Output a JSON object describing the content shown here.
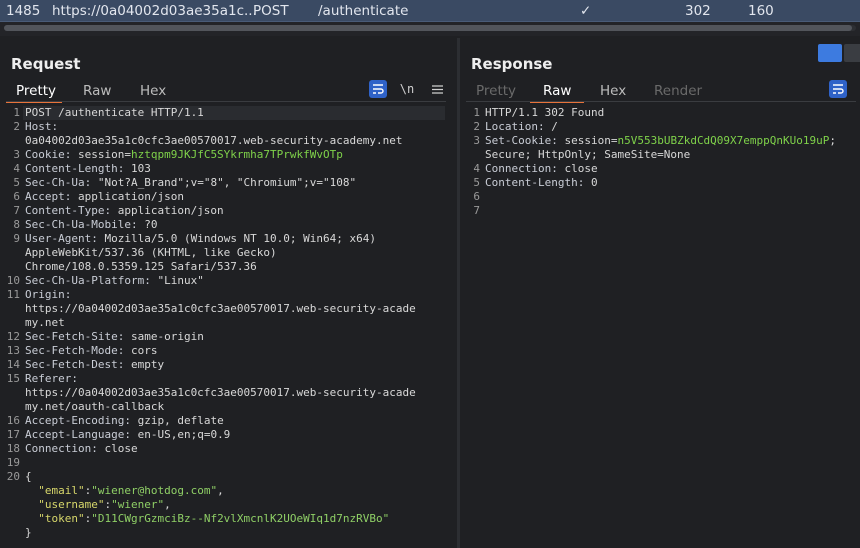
{
  "history_row": {
    "id": "1485",
    "host": "https://0a04002d03ae35a1c...",
    "method": "POST",
    "path": "/authenticate",
    "check": "✓",
    "status": "302",
    "length": "160"
  },
  "request": {
    "title": "Request",
    "tabs": [
      "Pretty",
      "Raw",
      "Hex"
    ],
    "active_tab": "Pretty",
    "newline_toggle": "\\n",
    "menu_icon": "hamburger-icon",
    "lines": [
      {
        "n": "1",
        "parts": [
          {
            "t": "POST /authenticate HTTP/1.1",
            "c": "hv"
          }
        ]
      },
      {
        "n": "2",
        "parts": [
          {
            "t": "Host:",
            "c": "hk"
          }
        ]
      },
      {
        "n": "",
        "parts": [
          {
            "t": "0a04002d03ae35a1c0cfc3ae00570017.web-security-academy.net",
            "c": "hv"
          }
        ]
      },
      {
        "n": "3",
        "parts": [
          {
            "t": "Cookie: ",
            "c": "hk"
          },
          {
            "t": "session",
            "c": "hv"
          },
          {
            "t": "=",
            "c": "hv"
          },
          {
            "t": "hztqpm9JKJfC5SYkrmha7TPrwkfWvOTp",
            "c": "sv"
          }
        ]
      },
      {
        "n": "4",
        "parts": [
          {
            "t": "Content-Length: ",
            "c": "hk"
          },
          {
            "t": "103",
            "c": "hv"
          }
        ]
      },
      {
        "n": "5",
        "parts": [
          {
            "t": "Sec-Ch-Ua: ",
            "c": "hk"
          },
          {
            "t": "\"Not?A_Brand\";v=\"8\", \"Chromium\";v=\"108\"",
            "c": "hv"
          }
        ]
      },
      {
        "n": "6",
        "parts": [
          {
            "t": "Accept: ",
            "c": "hk"
          },
          {
            "t": "application/json",
            "c": "hv"
          }
        ]
      },
      {
        "n": "7",
        "parts": [
          {
            "t": "Content-Type: ",
            "c": "hk"
          },
          {
            "t": "application/json",
            "c": "hv"
          }
        ]
      },
      {
        "n": "8",
        "parts": [
          {
            "t": "Sec-Ch-Ua-Mobile: ",
            "c": "hk"
          },
          {
            "t": "?0",
            "c": "hv"
          }
        ]
      },
      {
        "n": "9",
        "parts": [
          {
            "t": "User-Agent: ",
            "c": "hk"
          },
          {
            "t": "Mozilla/5.0 (Windows NT 10.0; Win64; x64)",
            "c": "hv"
          }
        ]
      },
      {
        "n": "",
        "parts": [
          {
            "t": "AppleWebKit/537.36 (KHTML, like Gecko)",
            "c": "hv"
          }
        ]
      },
      {
        "n": "",
        "parts": [
          {
            "t": "Chrome/108.0.5359.125 Safari/537.36",
            "c": "hv"
          }
        ]
      },
      {
        "n": "10",
        "parts": [
          {
            "t": "Sec-Ch-Ua-Platform: ",
            "c": "hk"
          },
          {
            "t": "\"Linux\"",
            "c": "hv"
          }
        ]
      },
      {
        "n": "11",
        "parts": [
          {
            "t": "Origin:",
            "c": "hk"
          }
        ]
      },
      {
        "n": "",
        "parts": [
          {
            "t": "https://0a04002d03ae35a1c0cfc3ae00570017.web-security-acade",
            "c": "hv"
          }
        ]
      },
      {
        "n": "",
        "parts": [
          {
            "t": "my.net",
            "c": "hv"
          }
        ]
      },
      {
        "n": "12",
        "parts": [
          {
            "t": "Sec-Fetch-Site: ",
            "c": "hk"
          },
          {
            "t": "same-origin",
            "c": "hv"
          }
        ]
      },
      {
        "n": "13",
        "parts": [
          {
            "t": "Sec-Fetch-Mode: ",
            "c": "hk"
          },
          {
            "t": "cors",
            "c": "hv"
          }
        ]
      },
      {
        "n": "14",
        "parts": [
          {
            "t": "Sec-Fetch-Dest: ",
            "c": "hk"
          },
          {
            "t": "empty",
            "c": "hv"
          }
        ]
      },
      {
        "n": "15",
        "parts": [
          {
            "t": "Referer:",
            "c": "hk"
          }
        ]
      },
      {
        "n": "",
        "parts": [
          {
            "t": "https://0a04002d03ae35a1c0cfc3ae00570017.web-security-acade",
            "c": "hv"
          }
        ]
      },
      {
        "n": "",
        "parts": [
          {
            "t": "my.net/oauth-callback",
            "c": "hv"
          }
        ]
      },
      {
        "n": "16",
        "parts": [
          {
            "t": "Accept-Encoding: ",
            "c": "hk"
          },
          {
            "t": "gzip, deflate",
            "c": "hv"
          }
        ]
      },
      {
        "n": "17",
        "parts": [
          {
            "t": "Accept-Language: ",
            "c": "hk"
          },
          {
            "t": "en-US,en;q=0.9",
            "c": "hv"
          }
        ]
      },
      {
        "n": "18",
        "parts": [
          {
            "t": "Connection: ",
            "c": "hk"
          },
          {
            "t": "close",
            "c": "hv"
          }
        ]
      },
      {
        "n": "19",
        "parts": []
      },
      {
        "n": "20",
        "parts": [
          {
            "t": "{",
            "c": "hv"
          }
        ]
      },
      {
        "n": "",
        "parts": [
          {
            "t": "  ",
            "c": "hv"
          },
          {
            "t": "\"email\"",
            "c": "jk"
          },
          {
            "t": ":",
            "c": "hv"
          },
          {
            "t": "\"wiener@hotdog.com\"",
            "c": "jv"
          },
          {
            "t": ",",
            "c": "hv"
          }
        ]
      },
      {
        "n": "",
        "parts": [
          {
            "t": "  ",
            "c": "hv"
          },
          {
            "t": "\"username\"",
            "c": "jk"
          },
          {
            "t": ":",
            "c": "hv"
          },
          {
            "t": "\"wiener\"",
            "c": "jv"
          },
          {
            "t": ",",
            "c": "hv"
          }
        ]
      },
      {
        "n": "",
        "parts": [
          {
            "t": "  ",
            "c": "hv"
          },
          {
            "t": "\"token\"",
            "c": "jk"
          },
          {
            "t": ":",
            "c": "hv"
          },
          {
            "t": "\"D11CWgrGzmciBz--Nf2vlXmcnlK2UOeWIq1d7nzRVBo\"",
            "c": "jv"
          }
        ]
      },
      {
        "n": "",
        "parts": [
          {
            "t": "}",
            "c": "hv"
          }
        ]
      }
    ]
  },
  "response": {
    "title": "Response",
    "tabs": [
      "Pretty",
      "Raw",
      "Hex",
      "Render"
    ],
    "active_tab": "Raw",
    "lines": [
      {
        "n": "1",
        "parts": [
          {
            "t": "HTTP/1.1 302 Found",
            "c": "hv"
          }
        ]
      },
      {
        "n": "2",
        "parts": [
          {
            "t": "Location: ",
            "c": "hk"
          },
          {
            "t": "/",
            "c": "hv"
          }
        ]
      },
      {
        "n": "3",
        "parts": [
          {
            "t": "Set-Cookie: ",
            "c": "hk"
          },
          {
            "t": "session",
            "c": "hv"
          },
          {
            "t": "=",
            "c": "hv"
          },
          {
            "t": "n5V553bUBZkdCdQ09X7emppQnKUo19uP",
            "c": "sv"
          },
          {
            "t": ";",
            "c": "hv"
          }
        ]
      },
      {
        "n": "",
        "parts": [
          {
            "t": "Secure; HttpOnly; SameSite=None",
            "c": "hv"
          }
        ]
      },
      {
        "n": "4",
        "parts": [
          {
            "t": "Connection: ",
            "c": "hk"
          },
          {
            "t": "close",
            "c": "hv"
          }
        ]
      },
      {
        "n": "5",
        "parts": [
          {
            "t": "Content-Length: ",
            "c": "hk"
          },
          {
            "t": "0",
            "c": "hv"
          }
        ]
      },
      {
        "n": "6",
        "parts": []
      },
      {
        "n": "7",
        "parts": []
      }
    ]
  },
  "colors": {
    "accent_tab": "#e8733a",
    "button_blue": "#2f62c8",
    "selected_row": "#3a4a63"
  }
}
